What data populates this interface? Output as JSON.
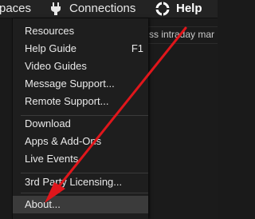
{
  "menubar": {
    "workspaces_label": "paces",
    "connections_label": "Connections",
    "help_label": "Help"
  },
  "background": {
    "partial_text": "ss intraday mar"
  },
  "help_menu": {
    "items": [
      {
        "label": "Resources",
        "shortcut": ""
      },
      {
        "label": "Help Guide",
        "shortcut": "F1"
      },
      {
        "label": "Video Guides",
        "shortcut": ""
      },
      {
        "label": "Message Support...",
        "shortcut": ""
      },
      {
        "label": "Remote Support...",
        "shortcut": ""
      },
      {
        "label": "Download",
        "shortcut": ""
      },
      {
        "label": "Apps & Add-Ons",
        "shortcut": ""
      },
      {
        "label": "Live Events",
        "shortcut": ""
      },
      {
        "label": "3rd Party Licensing...",
        "shortcut": ""
      },
      {
        "label": "About...",
        "shortcut": ""
      }
    ]
  },
  "annotation": {
    "arrow_color": "#e0161b"
  },
  "icons": {
    "connections": "plug-icon",
    "help": "help-circle-icon"
  }
}
